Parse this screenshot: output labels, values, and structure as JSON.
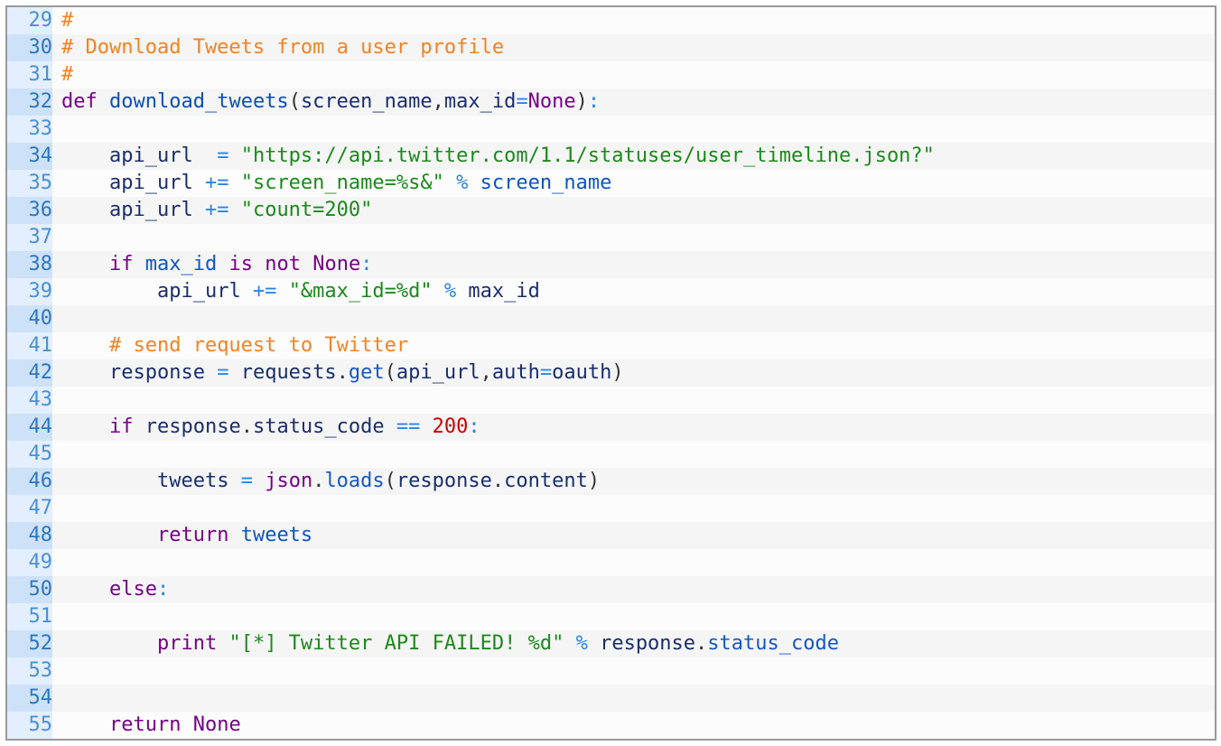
{
  "editor": {
    "language": "python",
    "lines": [
      {
        "n": "29",
        "tokens": [
          [
            "cm",
            "#"
          ]
        ]
      },
      {
        "n": "30",
        "tokens": [
          [
            "cm",
            "# Download Tweets from a user profile"
          ]
        ]
      },
      {
        "n": "31",
        "tokens": [
          [
            "cm",
            "#"
          ]
        ]
      },
      {
        "n": "32",
        "tokens": [
          [
            "kw",
            "def"
          ],
          [
            "pn",
            " "
          ],
          [
            "def",
            "download_tweets"
          ],
          [
            "pn",
            "("
          ],
          [
            "var",
            "screen_name"
          ],
          [
            "pn",
            ","
          ],
          [
            "var",
            "max_id"
          ],
          [
            "op",
            "="
          ],
          [
            "kw",
            "None"
          ],
          [
            "pn",
            ")"
          ],
          [
            "op",
            ":"
          ]
        ]
      },
      {
        "n": "33",
        "tokens": []
      },
      {
        "n": "34",
        "tokens": [
          [
            "pn",
            "    "
          ],
          [
            "var",
            "api_url"
          ],
          [
            "pn",
            "  "
          ],
          [
            "op",
            "="
          ],
          [
            "pn",
            " "
          ],
          [
            "str",
            "\"https://api.twitter.com/1.1/statuses/user_timeline.json?\""
          ]
        ]
      },
      {
        "n": "35",
        "tokens": [
          [
            "pn",
            "    "
          ],
          [
            "var",
            "api_url"
          ],
          [
            "pn",
            " "
          ],
          [
            "op",
            "+="
          ],
          [
            "pn",
            " "
          ],
          [
            "str",
            "\"screen_name=%s&\""
          ],
          [
            "pn",
            " "
          ],
          [
            "op",
            "%"
          ],
          [
            "pn",
            " "
          ],
          [
            "v2",
            "screen_name"
          ]
        ]
      },
      {
        "n": "36",
        "tokens": [
          [
            "pn",
            "    "
          ],
          [
            "var",
            "api_url"
          ],
          [
            "pn",
            " "
          ],
          [
            "op",
            "+="
          ],
          [
            "pn",
            " "
          ],
          [
            "str",
            "\"count=200\""
          ]
        ]
      },
      {
        "n": "37",
        "tokens": []
      },
      {
        "n": "38",
        "tokens": [
          [
            "pn",
            "    "
          ],
          [
            "kw",
            "if"
          ],
          [
            "pn",
            " "
          ],
          [
            "v2",
            "max_id"
          ],
          [
            "pn",
            " "
          ],
          [
            "kw",
            "is"
          ],
          [
            "pn",
            " "
          ],
          [
            "kw",
            "not"
          ],
          [
            "pn",
            " "
          ],
          [
            "kw",
            "None"
          ],
          [
            "op",
            ":"
          ]
        ]
      },
      {
        "n": "39",
        "tokens": [
          [
            "pn",
            "        "
          ],
          [
            "var",
            "api_url"
          ],
          [
            "pn",
            " "
          ],
          [
            "op",
            "+="
          ],
          [
            "pn",
            " "
          ],
          [
            "str",
            "\"&max_id=%d\""
          ],
          [
            "pn",
            " "
          ],
          [
            "op",
            "%"
          ],
          [
            "pn",
            " "
          ],
          [
            "var",
            "max_id"
          ]
        ]
      },
      {
        "n": "40",
        "tokens": []
      },
      {
        "n": "41",
        "tokens": [
          [
            "pn",
            "    "
          ],
          [
            "cm",
            "# send request to Twitter"
          ]
        ]
      },
      {
        "n": "42",
        "tokens": [
          [
            "pn",
            "    "
          ],
          [
            "var",
            "response"
          ],
          [
            "pn",
            " "
          ],
          [
            "op",
            "="
          ],
          [
            "pn",
            " "
          ],
          [
            "var",
            "requests"
          ],
          [
            "pn",
            "."
          ],
          [
            "prop",
            "get"
          ],
          [
            "pn",
            "("
          ],
          [
            "var",
            "api_url"
          ],
          [
            "pn",
            ","
          ],
          [
            "var",
            "auth"
          ],
          [
            "op",
            "="
          ],
          [
            "var",
            "oauth"
          ],
          [
            "pn",
            ")"
          ]
        ]
      },
      {
        "n": "43",
        "tokens": []
      },
      {
        "n": "44",
        "tokens": [
          [
            "pn",
            "    "
          ],
          [
            "kw",
            "if"
          ],
          [
            "pn",
            " "
          ],
          [
            "var",
            "response"
          ],
          [
            "pn",
            "."
          ],
          [
            "var",
            "status_code"
          ],
          [
            "pn",
            " "
          ],
          [
            "op",
            "=="
          ],
          [
            "pn",
            " "
          ],
          [
            "num",
            "200"
          ],
          [
            "op",
            ":"
          ]
        ]
      },
      {
        "n": "45",
        "tokens": []
      },
      {
        "n": "46",
        "tokens": [
          [
            "pn",
            "        "
          ],
          [
            "var",
            "tweets"
          ],
          [
            "pn",
            " "
          ],
          [
            "op",
            "="
          ],
          [
            "pn",
            " "
          ],
          [
            "bi",
            "json"
          ],
          [
            "pn",
            "."
          ],
          [
            "prop",
            "loads"
          ],
          [
            "pn",
            "("
          ],
          [
            "var",
            "response"
          ],
          [
            "pn",
            "."
          ],
          [
            "var",
            "content"
          ],
          [
            "pn",
            ")"
          ]
        ]
      },
      {
        "n": "47",
        "tokens": []
      },
      {
        "n": "48",
        "tokens": [
          [
            "pn",
            "        "
          ],
          [
            "kw",
            "return"
          ],
          [
            "pn",
            " "
          ],
          [
            "v2",
            "tweets"
          ]
        ]
      },
      {
        "n": "49",
        "tokens": []
      },
      {
        "n": "50",
        "tokens": [
          [
            "pn",
            "    "
          ],
          [
            "kw",
            "else"
          ],
          [
            "op",
            ":"
          ]
        ]
      },
      {
        "n": "51",
        "tokens": []
      },
      {
        "n": "52",
        "tokens": [
          [
            "pn",
            "        "
          ],
          [
            "kw",
            "print"
          ],
          [
            "pn",
            " "
          ],
          [
            "str",
            "\"[*] Twitter API FAILED! %d\""
          ],
          [
            "pn",
            " "
          ],
          [
            "op",
            "%"
          ],
          [
            "pn",
            " "
          ],
          [
            "var",
            "response"
          ],
          [
            "pn",
            "."
          ],
          [
            "prop",
            "status_code"
          ]
        ]
      },
      {
        "n": "53",
        "tokens": []
      },
      {
        "n": "54",
        "tokens": []
      },
      {
        "n": "55",
        "tokens": [
          [
            "pn",
            "    "
          ],
          [
            "kw",
            "return"
          ],
          [
            "pn",
            " "
          ],
          [
            "kw",
            "None"
          ]
        ]
      }
    ]
  }
}
